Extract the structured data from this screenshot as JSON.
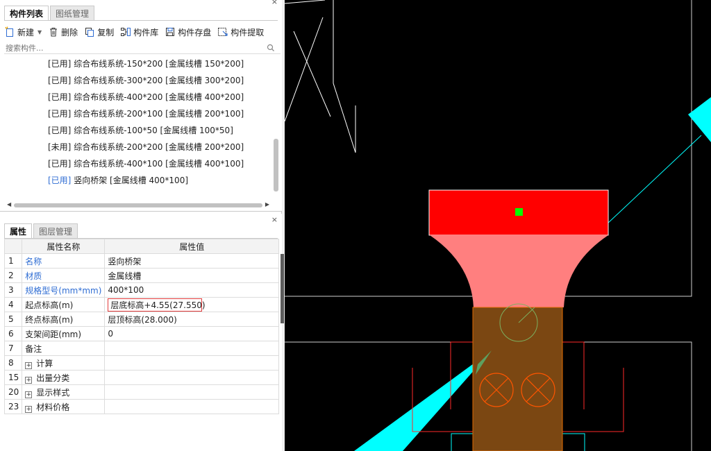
{
  "top_panel": {
    "tabs": [
      {
        "label": "构件列表",
        "active": true
      },
      {
        "label": "图纸管理",
        "active": false
      }
    ],
    "close_glyph": "×",
    "toolbar": {
      "new_label": "新建",
      "delete_label": "删除",
      "copy_label": "复制",
      "library_label": "构件库",
      "save_label": "构件存盘",
      "extract_label": "构件提取"
    },
    "search": {
      "placeholder": "搜索构件..."
    },
    "items": [
      {
        "status": "[已用]",
        "text": "综合布线系统-150*200 [金属线槽 150*200]",
        "selected": false
      },
      {
        "status": "[已用]",
        "text": "综合布线系统-300*200 [金属线槽 300*200]",
        "selected": false
      },
      {
        "status": "[已用]",
        "text": "综合布线系统-400*200 [金属线槽 400*200]",
        "selected": false
      },
      {
        "status": "[已用]",
        "text": "综合布线系统-200*100 [金属线槽 200*100]",
        "selected": false
      },
      {
        "status": "[已用]",
        "text": "综合布线系统-100*50 [金属线槽 100*50]",
        "selected": false
      },
      {
        "status": "[未用]",
        "text": "综合布线系统-200*200 [金属线槽 200*200]",
        "selected": false
      },
      {
        "status": "[已用]",
        "text": "综合布线系统-400*100 [金属线槽 400*100]",
        "selected": false
      },
      {
        "status": "[已用]",
        "text": "竖向桥架 [金属线槽 400*100]",
        "selected": true
      }
    ]
  },
  "prop_panel": {
    "tabs": [
      {
        "label": "属性",
        "active": true
      },
      {
        "label": "图层管理",
        "active": false
      }
    ],
    "close_glyph": "×",
    "headers": {
      "name": "属性名称",
      "value": "属性值"
    },
    "rows": [
      {
        "num": "1",
        "name": "名称",
        "value": "竖向桥架",
        "blue": true
      },
      {
        "num": "2",
        "name": "材质",
        "value": "金属线槽",
        "blue": true
      },
      {
        "num": "3",
        "name": "规格型号(mm*mm)",
        "value": "400*100",
        "blue": true
      },
      {
        "num": "4",
        "name": "起点标高(m)",
        "value": "层底标高+4.55(27.550)",
        "blue": false,
        "highlight": true
      },
      {
        "num": "5",
        "name": "终点标高(m)",
        "value": "层顶标高(28.000)",
        "blue": false
      },
      {
        "num": "6",
        "name": "支架间距(mm)",
        "value": "0",
        "blue": false
      },
      {
        "num": "7",
        "name": "备注",
        "value": "",
        "blue": false
      },
      {
        "num": "8",
        "name": "计算",
        "value": "",
        "expandable": true
      },
      {
        "num": "15",
        "name": "出量分类",
        "value": "",
        "expandable": true
      },
      {
        "num": "20",
        "name": "显示样式",
        "value": "",
        "expandable": true
      },
      {
        "num": "23",
        "name": "材料价格",
        "value": "",
        "expandable": true
      }
    ]
  },
  "colors": {
    "canvas_bg": "#000000",
    "bridge_top": "#ff0000",
    "bridge_fan": "#ff7f7f",
    "bridge_body": "#7b4712",
    "marker": "#00ff00",
    "cyan": "#00ffff",
    "link_blue": "#2f6dd3",
    "highlight_border": "#e23b3b"
  },
  "icons": [
    "new-icon",
    "delete-icon",
    "copy-icon",
    "library-icon",
    "save-icon",
    "extract-icon",
    "search-icon",
    "close-icon"
  ]
}
